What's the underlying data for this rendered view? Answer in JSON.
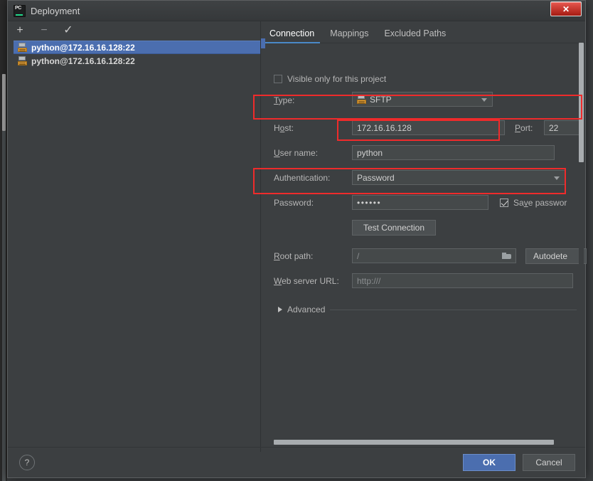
{
  "window": {
    "title": "Deployment",
    "app_icon": "pycharm-icon",
    "ghost_title": "",
    "close_label": "✕"
  },
  "left_pane": {
    "toolbar": [
      {
        "name": "add",
        "glyph": "+"
      },
      {
        "name": "remove",
        "glyph": "−"
      },
      {
        "name": "set-default",
        "glyph": "✓"
      }
    ],
    "servers": [
      {
        "label": "python@172.16.16.128:22",
        "selected": true,
        "icon": "sftp-server-icon"
      },
      {
        "label": "python@172.16.16.128:22",
        "selected": false,
        "icon": "sftp-server-icon"
      }
    ]
  },
  "tabs": [
    {
      "label": "Connection",
      "active": true
    },
    {
      "label": "Mappings",
      "active": false
    },
    {
      "label": "Excluded Paths",
      "active": false
    }
  ],
  "connection": {
    "visible_only_checkbox": {
      "label": "Visible only for this project",
      "checked": false
    },
    "type": {
      "label": "Type:",
      "value": "SFTP",
      "icon": "sftp-server-icon"
    },
    "host": {
      "label": "Host:",
      "value": "172.16.16.128"
    },
    "port": {
      "label": "Port:",
      "value": "22"
    },
    "user_name": {
      "label": "User name:",
      "value": "python"
    },
    "authentication": {
      "label": "Authentication:",
      "value": "Password"
    },
    "password": {
      "label": "Password:",
      "value": "••••••"
    },
    "save_password": {
      "label": "Save passwor",
      "checked": true
    },
    "test_connection": {
      "label": "Test Connection"
    },
    "root_path": {
      "label": "Root path:",
      "value": "/",
      "browse_icon": "folder-icon"
    },
    "autodetect": {
      "label": "Autodete"
    },
    "web_server_url": {
      "label": "Web server URL:",
      "value": "http:///"
    },
    "advanced": {
      "label": "Advanced",
      "expanded": false,
      "icon": "chevron-right-icon"
    }
  },
  "footer": {
    "help_label": "?",
    "ok_label": "OK",
    "cancel_label": "Cancel"
  },
  "colors": {
    "background": "#3c3f41",
    "accent_blue": "#4b6eaf",
    "tab_underline": "#4a88c7",
    "highlight_red": "#ef2b2b",
    "input_bg": "#45494a",
    "close_red": "#c62a20"
  },
  "annotations": {
    "note": "red rectangles highlight host/port, user name and password rows"
  }
}
